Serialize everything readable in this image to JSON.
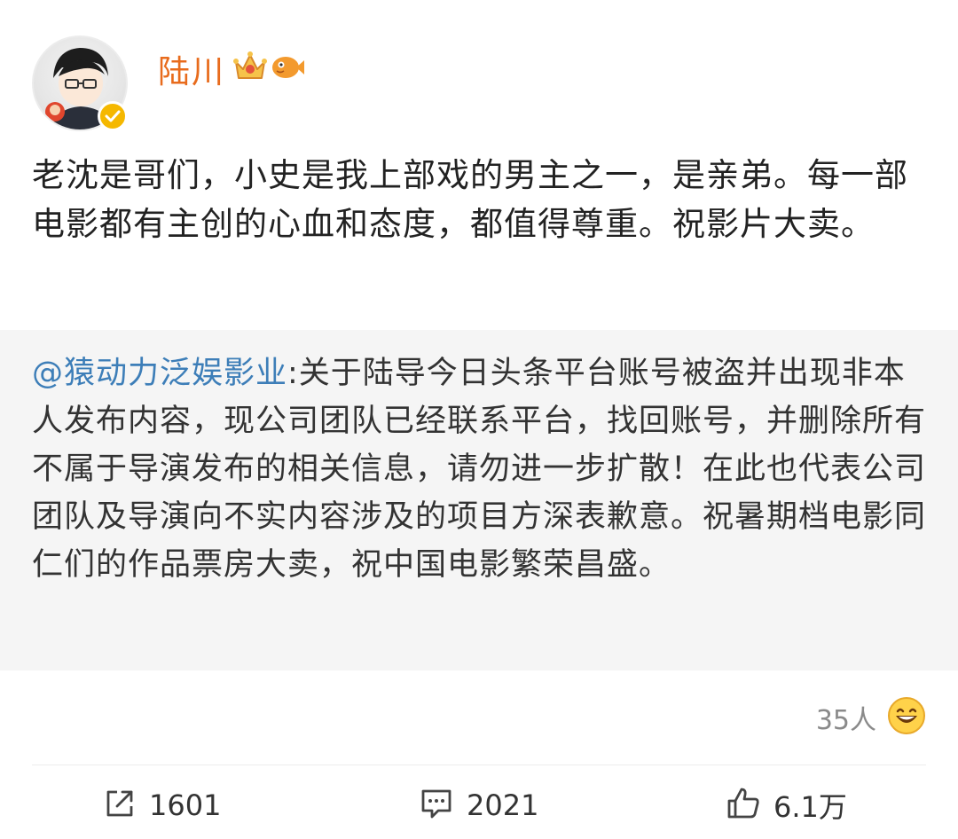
{
  "post": {
    "author": "陆川",
    "text": "老沈是哥们，小史是我上部戏的男主之一，是亲弟。每一部电影都有主创的心血和态度，都值得尊重。祝影片大卖。"
  },
  "repost": {
    "mention": "@猿动力泛娱影业",
    "text": ":关于陆导今日头条平台账号被盗并出现非本人发布内容，现公司团队已经联系平台，找回账号，并删除所有不属于导演发布的相关信息，请勿进一步扩散！在此也代表公司团队及导演向不实内容涉及的项目方深表歉意。祝暑期档电影同仁们的作品票房大卖，祝中国电影繁荣昌盛。"
  },
  "reactions": {
    "count": "35人",
    "icon": "grinning-face-icon"
  },
  "actions": {
    "repost_count": "1601",
    "comment_count": "2021",
    "like_count": "6.1万"
  },
  "colors": {
    "name": "#e86b1c",
    "mention": "#3d7eb8",
    "repost_bg": "#f5f5f5",
    "verified": "#f5b800"
  }
}
